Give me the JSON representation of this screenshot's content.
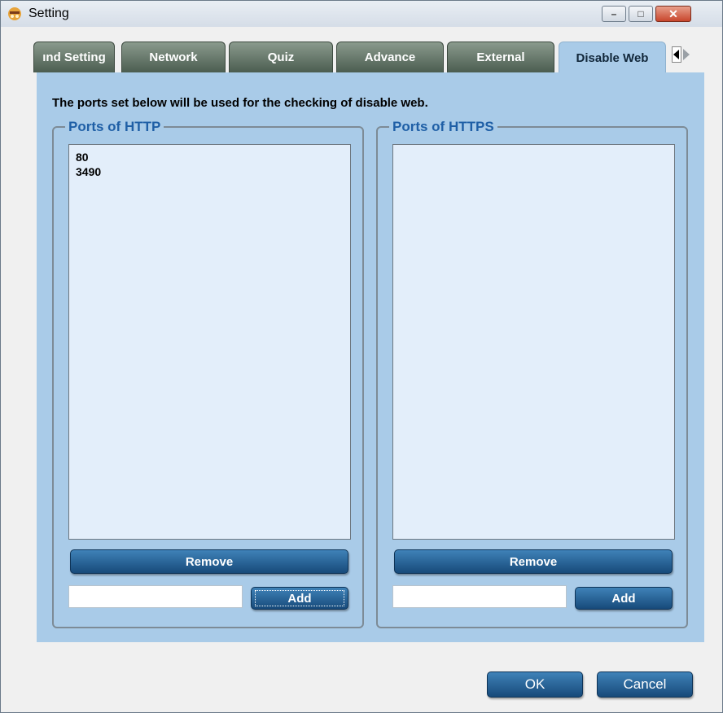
{
  "window": {
    "title": "Setting",
    "icon": "app-icon",
    "controls": {
      "minimize": "–",
      "maximize": "□",
      "close": "✕"
    }
  },
  "tabs": [
    {
      "label": "ınd Setting",
      "active": false
    },
    {
      "label": "Network",
      "active": false
    },
    {
      "label": "Quiz",
      "active": false
    },
    {
      "label": "Advance",
      "active": false
    },
    {
      "label": "External",
      "active": false
    },
    {
      "label": "Disable Web",
      "active": true
    }
  ],
  "tab_scroll": {
    "left_icon": "arrow-left-icon",
    "right_icon": "arrow-right-icon"
  },
  "panel": {
    "description": "The ports set below will be used for the checking of disable web.",
    "http": {
      "legend": "Ports of HTTP",
      "items": [
        "80",
        "3490"
      ],
      "remove_label": "Remove",
      "add_value": "",
      "add_label": "Add"
    },
    "https": {
      "legend": "Ports of HTTPS",
      "items": [],
      "remove_label": "Remove",
      "add_value": "",
      "add_label": "Add"
    }
  },
  "footer": {
    "ok_label": "OK",
    "cancel_label": "Cancel"
  },
  "colors": {
    "panel_bg": "#a9cbe8",
    "tab_inactive": "#4b5d50",
    "button_blue": "#174a7a",
    "legend_text": "#1f5fa6"
  }
}
